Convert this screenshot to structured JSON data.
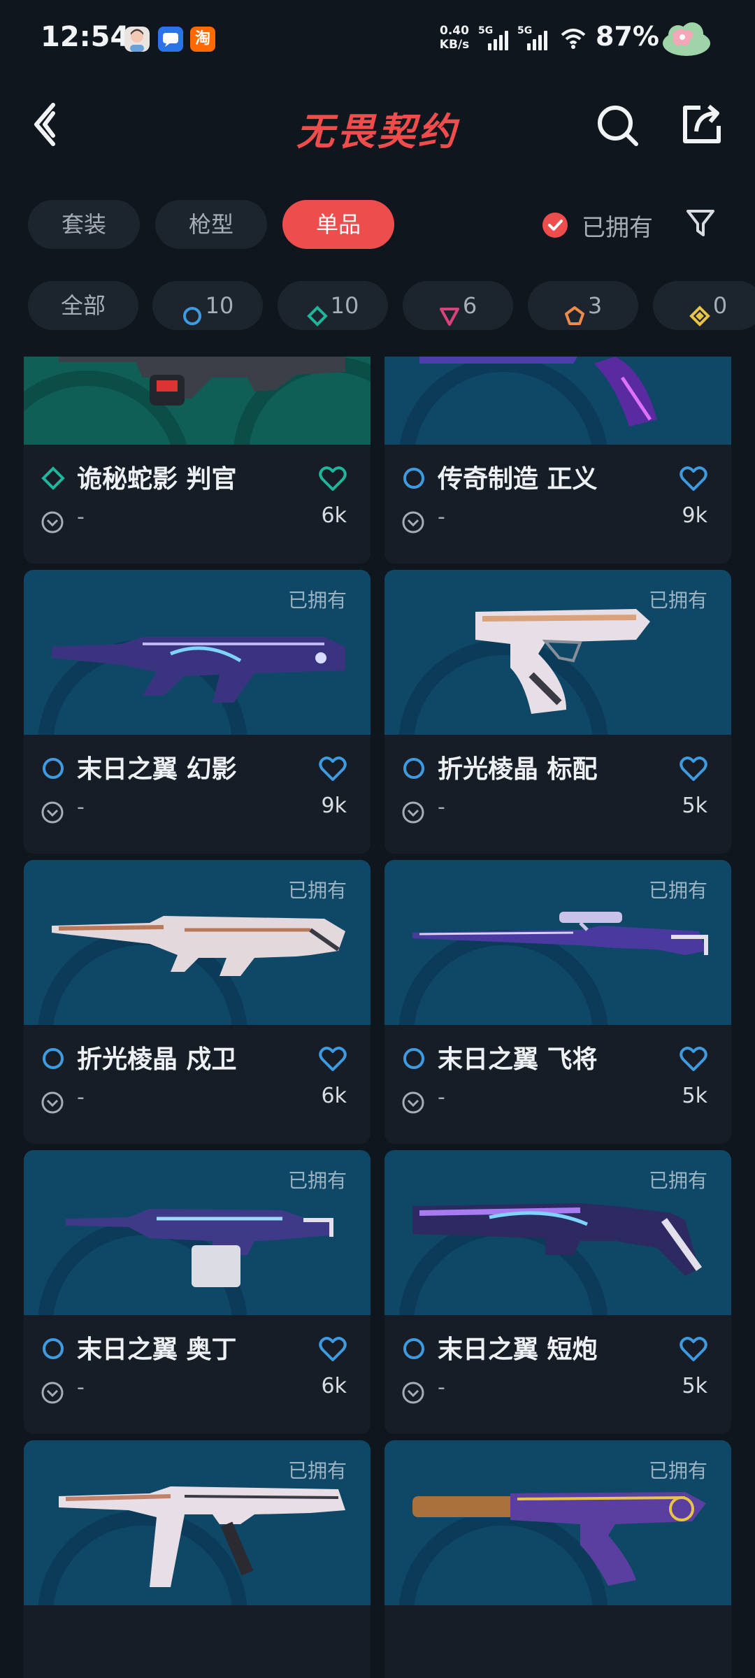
{
  "status_bar": {
    "time": "12:54",
    "app_icons": [
      "profile-app-icon",
      "messages-app-icon",
      "taobao-app-icon"
    ],
    "taobao_glyph": "淘",
    "net_speed_value": "0.40",
    "net_speed_unit": "KB/s",
    "sim1": "5G",
    "sim2": "5G",
    "battery": "87%"
  },
  "header": {
    "title": "无畏契约"
  },
  "tabs": [
    {
      "label": "套装",
      "active": false
    },
    {
      "label": "枪型",
      "active": false
    },
    {
      "label": "单品",
      "active": true
    }
  ],
  "owned_filter": {
    "label": "已拥有",
    "checked": true
  },
  "rarity_chips": [
    {
      "label": "全部",
      "icon": "",
      "color": ""
    },
    {
      "label": "10",
      "icon": "select-rarity-icon",
      "color": "#3f9be0"
    },
    {
      "label": "10",
      "icon": "deluxe-rarity-icon",
      "color": "#1fb59b"
    },
    {
      "label": "6",
      "icon": "premium-rarity-icon",
      "color": "#d9437c"
    },
    {
      "label": "3",
      "icon": "exclusive-rarity-icon",
      "color": "#f08a4b"
    },
    {
      "label": "0",
      "icon": "ultra-rarity-icon",
      "color": "#e8c34a"
    }
  ],
  "owned_tag": "已拥有",
  "skins": [
    {
      "name": "诡秘蛇影 判官",
      "rarity": "deluxe",
      "likes": "6k",
      "price": "-",
      "bg": "teal"
    },
    {
      "name": "传奇制造 正义",
      "rarity": "select",
      "likes": "9k",
      "price": "-",
      "bg": "blue"
    },
    {
      "name": "末日之翼 幻影",
      "rarity": "select",
      "likes": "9k",
      "price": "-",
      "bg": "blue"
    },
    {
      "name": "折光棱晶 标配",
      "rarity": "select",
      "likes": "5k",
      "price": "-",
      "bg": "blue"
    },
    {
      "name": "折光棱晶 戍卫",
      "rarity": "select",
      "likes": "6k",
      "price": "-",
      "bg": "blue"
    },
    {
      "name": "末日之翼 飞将",
      "rarity": "select",
      "likes": "5k",
      "price": "-",
      "bg": "blue"
    },
    {
      "name": "末日之翼 奥丁",
      "rarity": "select",
      "likes": "6k",
      "price": "-",
      "bg": "blue"
    },
    {
      "name": "末日之翼 短炮",
      "rarity": "select",
      "likes": "5k",
      "price": "-",
      "bg": "blue"
    },
    {
      "name": "",
      "rarity": "",
      "likes": "",
      "price": "",
      "bg": "blue"
    },
    {
      "name": "",
      "rarity": "",
      "likes": "",
      "price": "",
      "bg": "blue"
    }
  ],
  "colors": {
    "background": "#10161e",
    "accent_red": "#ee4d4d",
    "select_blue": "#3f9be0",
    "deluxe_green": "#1fb59b"
  }
}
